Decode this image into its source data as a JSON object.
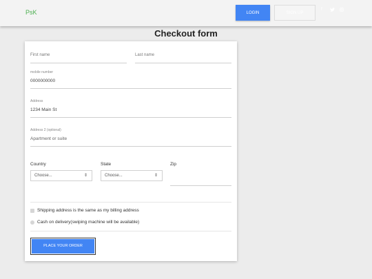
{
  "navbar": {
    "brand": "PsK",
    "login_label": "LOGIN",
    "signup_label": "SIGN UP",
    "social_icons": [
      "facebook-icon",
      "twitter-icon",
      "instagram-icon"
    ]
  },
  "page": {
    "title": "Checkout form"
  },
  "form": {
    "first_name_placeholder": "First name",
    "last_name_placeholder": "Last name",
    "mobile_label": "mobile number",
    "mobile_value": "0000000000",
    "address_label": "Address",
    "address_value": "1234 Main St",
    "address2_label": "Address 2 (optional)",
    "address2_placeholder": "Apartment or suite",
    "country_label": "Country",
    "country_value": "Choose...",
    "state_label": "State",
    "state_value": "Choose...",
    "zip_label": "Zip",
    "shipping_same_label": "Shipping address is the same as my billing address",
    "cod_label": "Cash on delivery(swiping machine will be available)",
    "submit_label": "PLACE YOUR ORDER"
  },
  "colors": {
    "primary": "#4285f4",
    "brand": "#4caf50",
    "background": "#ececec"
  }
}
